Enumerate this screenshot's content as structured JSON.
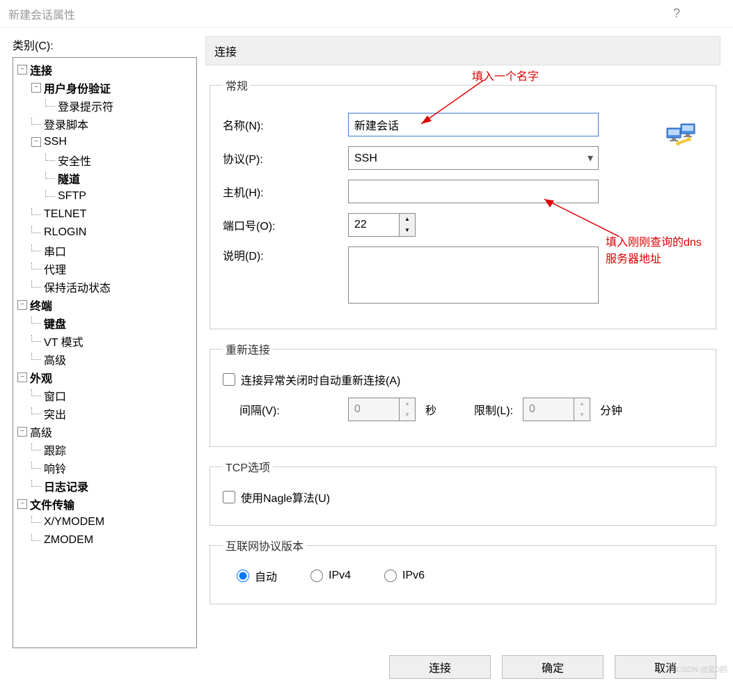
{
  "titlebar": {
    "title": "新建会话属性"
  },
  "sidebar": {
    "label": "类别(C):",
    "items": [
      {
        "label": "连接",
        "level": 1,
        "bold": true,
        "expand": "−"
      },
      {
        "label": "用户身份验证",
        "level": 2,
        "bold": true,
        "expand": "−"
      },
      {
        "label": "登录提示符",
        "level": 3
      },
      {
        "label": "登录脚本",
        "level": 2
      },
      {
        "label": "SSH",
        "level": 2,
        "expand": "−"
      },
      {
        "label": "安全性",
        "level": 3
      },
      {
        "label": "隧道",
        "level": 3,
        "bold": true
      },
      {
        "label": "SFTP",
        "level": 3
      },
      {
        "label": "TELNET",
        "level": 2
      },
      {
        "label": "RLOGIN",
        "level": 2
      },
      {
        "label": "串口",
        "level": 2
      },
      {
        "label": "代理",
        "level": 2
      },
      {
        "label": "保持活动状态",
        "level": 2
      },
      {
        "label": "终端",
        "level": 1,
        "bold": true,
        "expand": "−"
      },
      {
        "label": "键盘",
        "level": 2,
        "bold": true
      },
      {
        "label": "VT 模式",
        "level": 2
      },
      {
        "label": "高级",
        "level": 2
      },
      {
        "label": "外观",
        "level": 1,
        "bold": true,
        "expand": "−"
      },
      {
        "label": "窗口",
        "level": 2
      },
      {
        "label": "突出",
        "level": 2
      },
      {
        "label": "高级",
        "level": 1,
        "expand": "−"
      },
      {
        "label": "跟踪",
        "level": 2
      },
      {
        "label": "响铃",
        "level": 2
      },
      {
        "label": "日志记录",
        "level": 2,
        "bold": true
      },
      {
        "label": "文件传输",
        "level": 1,
        "bold": true,
        "expand": "−"
      },
      {
        "label": "X/YMODEM",
        "level": 2
      },
      {
        "label": "ZMODEM",
        "level": 2
      }
    ]
  },
  "panel": {
    "header": "连接"
  },
  "groups": {
    "general": {
      "legend": "常规",
      "name_label": "名称(N):",
      "name_value": "新建会话",
      "protocol_label": "协议(P):",
      "protocol_value": "SSH",
      "host_label": "主机(H):",
      "host_value": "",
      "port_label": "端口号(O):",
      "port_value": "22",
      "desc_label": "说明(D):",
      "desc_value": ""
    },
    "reconnect": {
      "legend": "重新连接",
      "checkbox_label": "连接异常关闭时自动重新连接(A)",
      "interval_label": "间隔(V):",
      "interval_value": "0",
      "interval_unit": "秒",
      "limit_label": "限制(L):",
      "limit_value": "0",
      "limit_unit": "分钟"
    },
    "tcp": {
      "legend": "TCP选项",
      "nagle_label": "使用Nagle算法(U)"
    },
    "ipver": {
      "legend": "互联网协议版本",
      "auto": "自动",
      "ipv4": "IPv4",
      "ipv6": "IPv6"
    }
  },
  "footer": {
    "connect": "连接",
    "ok": "确定",
    "cancel": "取消"
  },
  "annotations": {
    "a1": "填入一个名字",
    "a2_part1": "填入刚刚查询的",
    "a2_part2": "dns",
    "a2_part3": "服务器地址"
  },
  "watermark": "CSDN @蓝0鸥"
}
